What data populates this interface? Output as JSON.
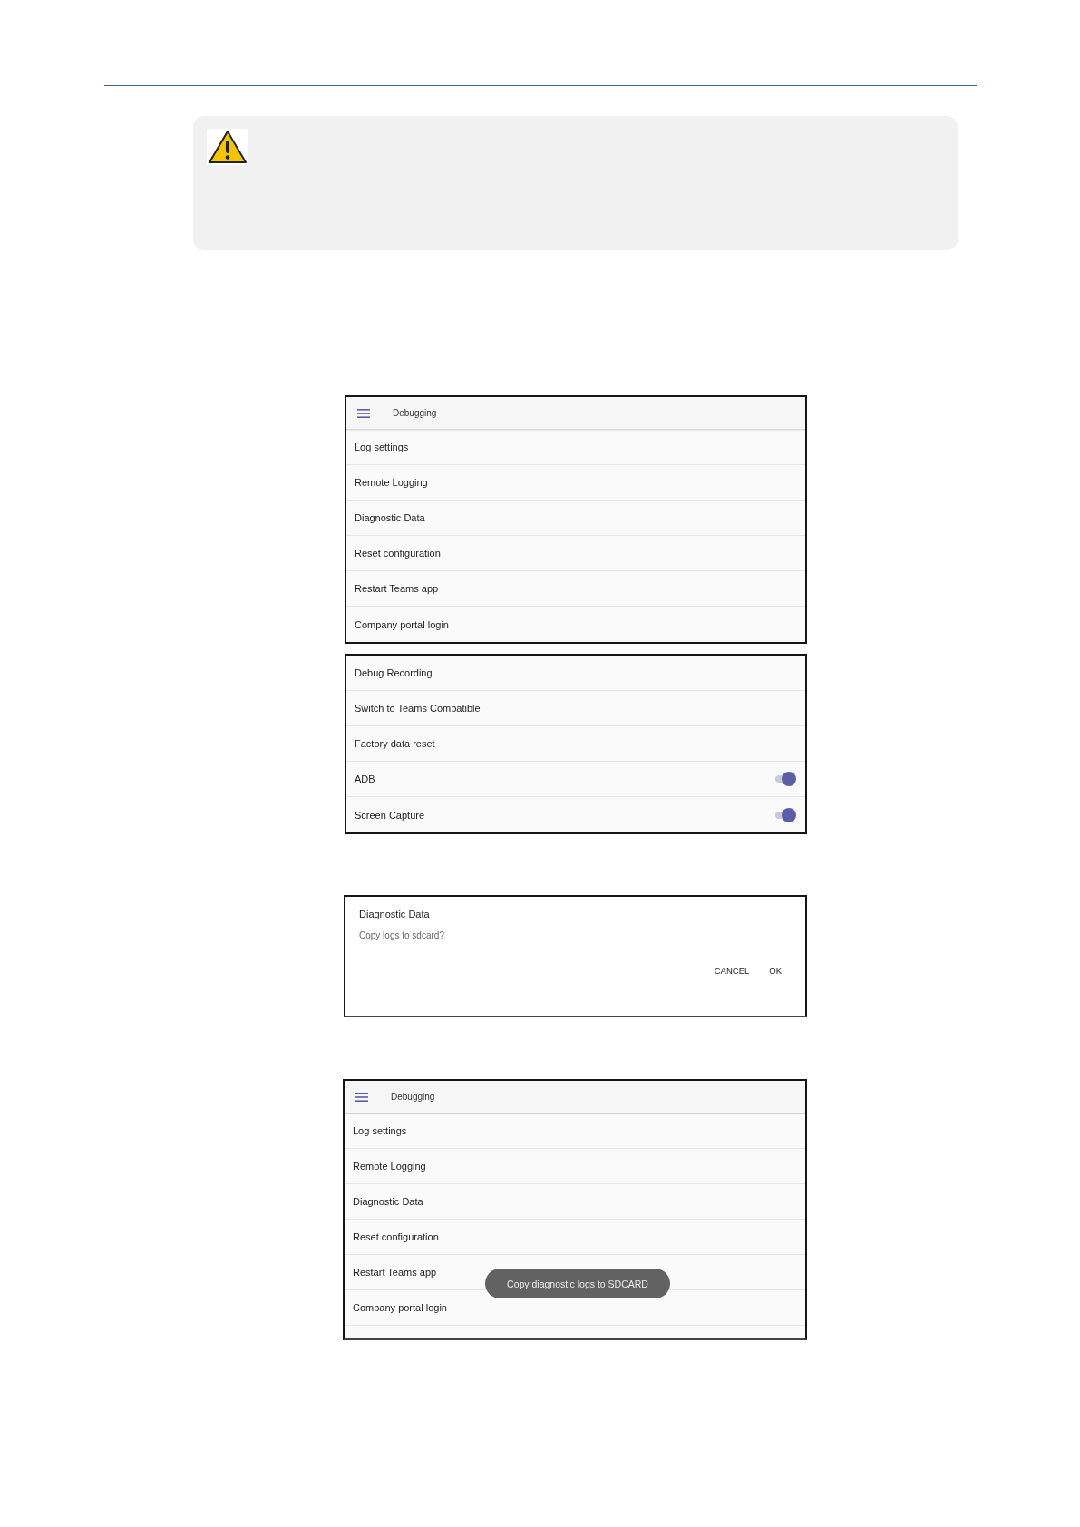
{
  "note": {
    "kind": "warning"
  },
  "debug_menu": {
    "title": "Debugging",
    "items": [
      "Log settings",
      "Remote Logging",
      "Diagnostic Data",
      "Reset configuration",
      "Restart Teams app",
      "Company portal login"
    ]
  },
  "debug_menu_more": {
    "items": [
      {
        "kind": "link",
        "label": "Debug Recording"
      },
      {
        "kind": "link",
        "label": "Switch to Teams Compatible"
      },
      {
        "kind": "link",
        "label": "Factory data reset"
      },
      {
        "kind": "toggle",
        "label": "ADB",
        "on": true
      },
      {
        "kind": "toggle",
        "label": "Screen Capture",
        "on": true
      }
    ]
  },
  "diagnostic_dialog": {
    "title": "Diagnostic Data",
    "message": "Copy logs to sdcard?",
    "buttons": [
      "CANCEL",
      "OK"
    ]
  },
  "debug_menu_with_toast": {
    "title": "Debugging",
    "items": [
      "Log settings",
      "Remote Logging",
      "Diagnostic Data",
      "Reset configuration",
      "Restart Teams app",
      "Company portal login"
    ],
    "toast": "Copy diagnostic logs to SDCARD"
  }
}
